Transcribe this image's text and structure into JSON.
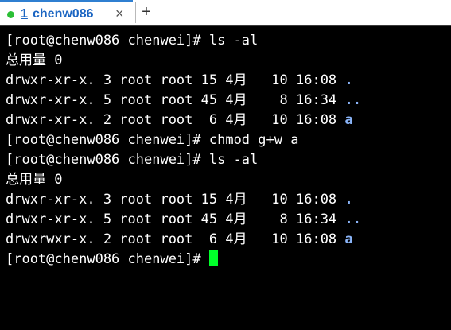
{
  "tab": {
    "number": "1",
    "title": "chenw086",
    "close_label": "×",
    "new_tab_label": "+"
  },
  "lines": [
    {
      "text": "[root@chenw086 chenwei]# ls -al"
    },
    {
      "text": "总用量 0"
    },
    {
      "prefix": "drwxr-xr-x. 3 root root 15 4月   10 16:08 ",
      "name": "."
    },
    {
      "prefix": "drwxr-xr-x. 5 root root 45 4月    8 16:34 ",
      "name": ".."
    },
    {
      "prefix": "drwxr-xr-x. 2 root root  6 4月   10 16:08 ",
      "name": "a"
    },
    {
      "text": "[root@chenw086 chenwei]# chmod g+w a"
    },
    {
      "text": "[root@chenw086 chenwei]# ls -al"
    },
    {
      "text": "总用量 0"
    },
    {
      "prefix": "drwxr-xr-x. 3 root root 15 4月   10 16:08 ",
      "name": "."
    },
    {
      "prefix": "drwxr-xr-x. 5 root root 45 4月    8 16:34 ",
      "name": ".."
    },
    {
      "prefix": "drwxrwxr-x. 2 root root  6 4月   10 16:08 ",
      "name": "a"
    },
    {
      "text": "[root@chenw086 chenwei]# "
    }
  ],
  "colors": {
    "cursor": "#00ff2a",
    "directory_name": "#8ab4f8",
    "tab_accent": "#1b65c2",
    "status_dot": "#2bbf35"
  }
}
